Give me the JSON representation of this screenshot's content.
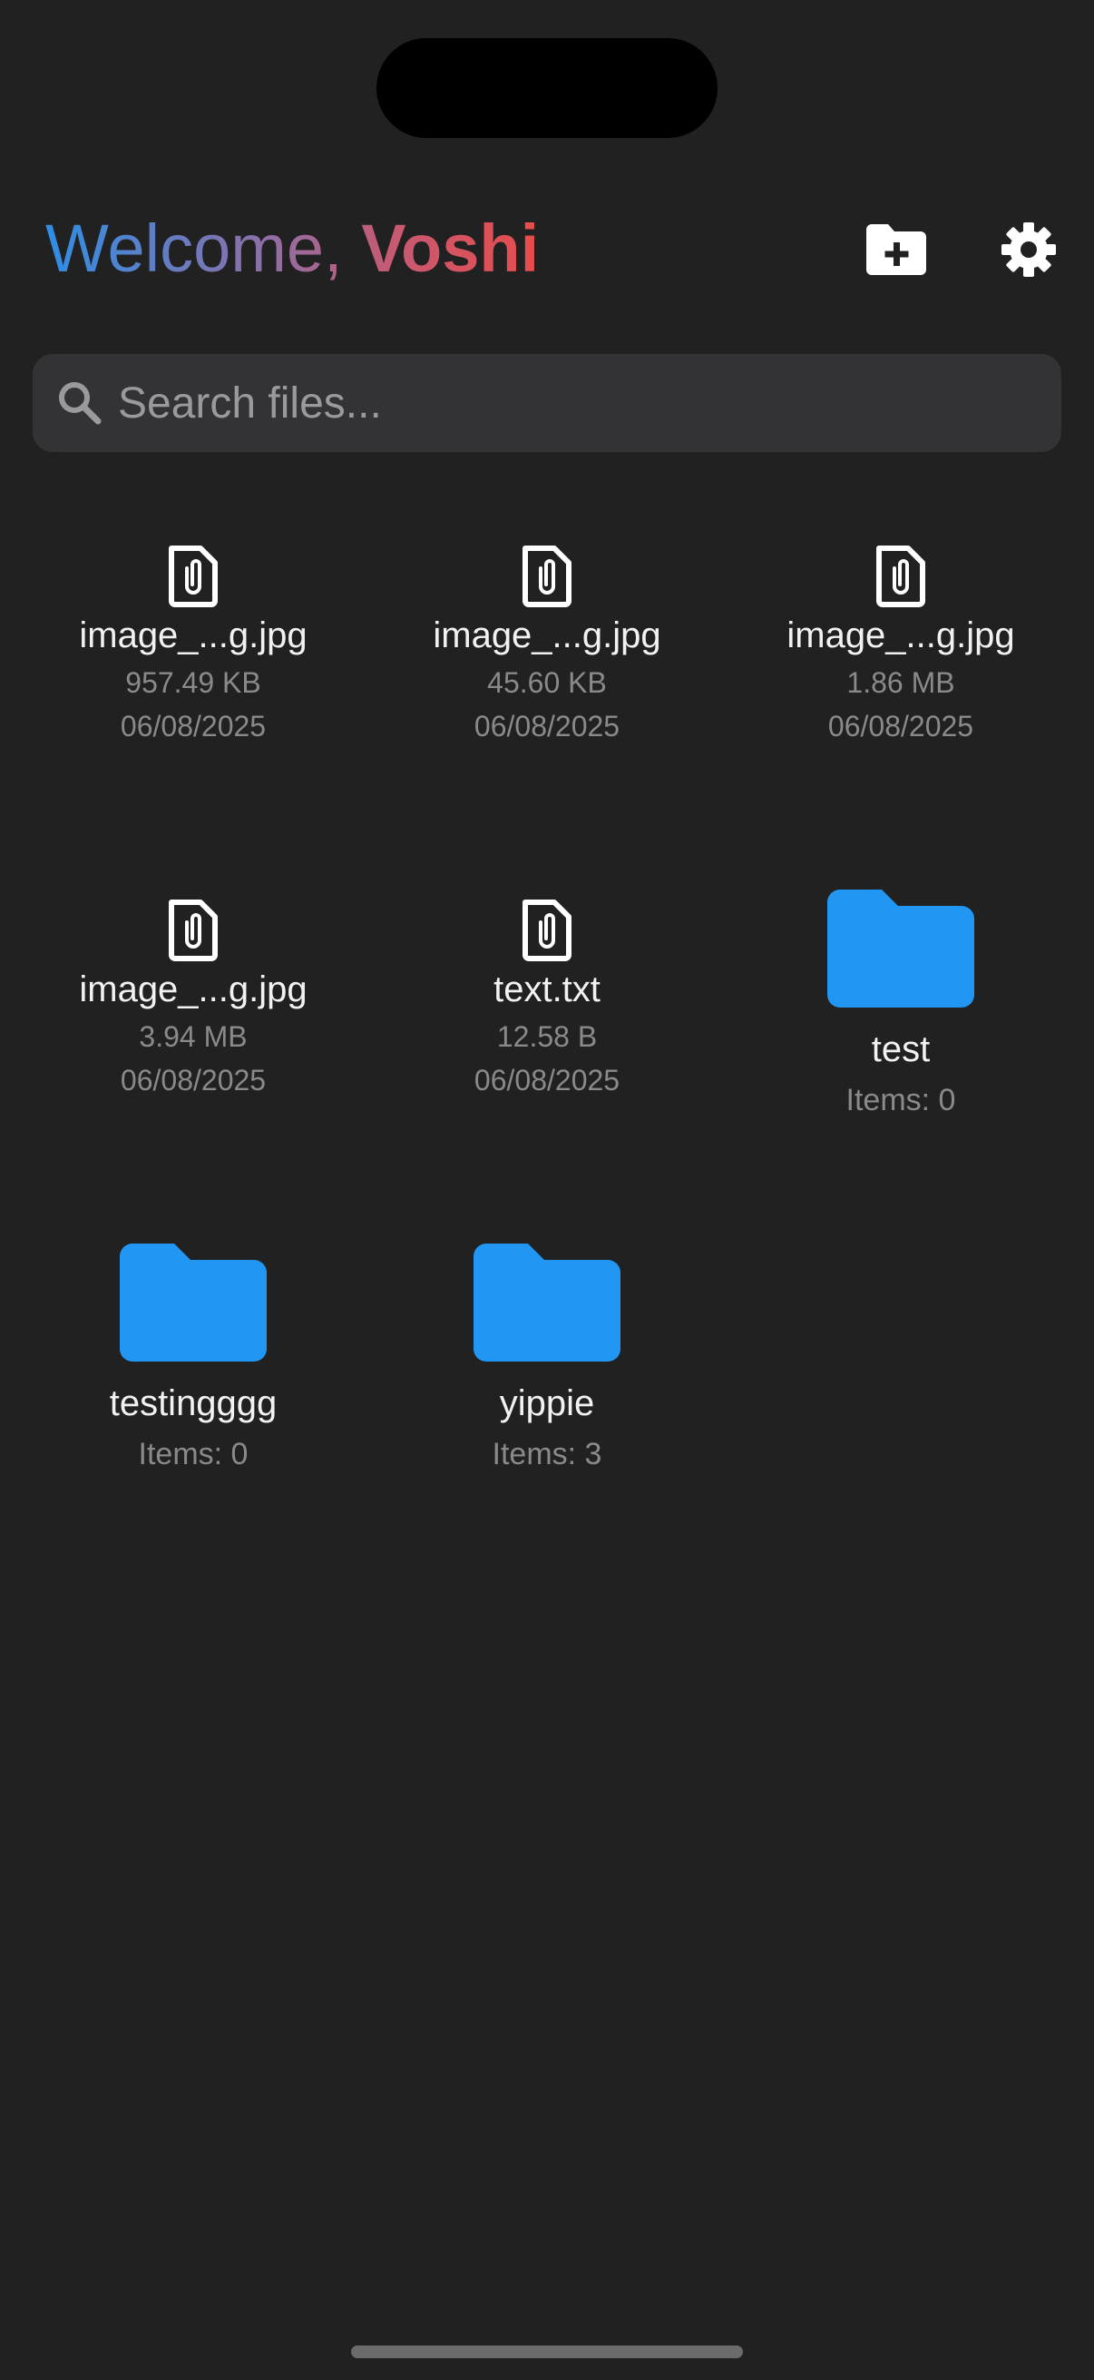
{
  "header": {
    "greeting": "Welcome, ",
    "user_name": "Voshi"
  },
  "icons": {
    "new_folder": "create-new-folder-icon",
    "settings": "gear-icon",
    "search": "search-icon",
    "file": "attachment-file-icon",
    "folder": "folder-icon"
  },
  "colors": {
    "background": "#212121",
    "folder": "#2196f3",
    "gradient_start": "#2f8ee6",
    "gradient_end": "#e84c4c"
  },
  "search": {
    "placeholder": "Search files...",
    "value": ""
  },
  "items": [
    {
      "type": "file",
      "name": "image_...g.jpg",
      "size": "957.49 KB",
      "date": "06/08/2025"
    },
    {
      "type": "file",
      "name": "image_...g.jpg",
      "size": "45.60 KB",
      "date": "06/08/2025"
    },
    {
      "type": "file",
      "name": "image_...g.jpg",
      "size": "1.86 MB",
      "date": "06/08/2025"
    },
    {
      "type": "file",
      "name": "image_...g.jpg",
      "size": "3.94 MB",
      "date": "06/08/2025"
    },
    {
      "type": "file",
      "name": "text.txt",
      "size": "12.58 B",
      "date": "06/08/2025"
    },
    {
      "type": "folder",
      "name": "test",
      "count": "Items: 0"
    },
    {
      "type": "folder",
      "name": "testingggg",
      "count": "Items: 0"
    },
    {
      "type": "folder",
      "name": "yippie",
      "count": "Items: 3"
    }
  ]
}
